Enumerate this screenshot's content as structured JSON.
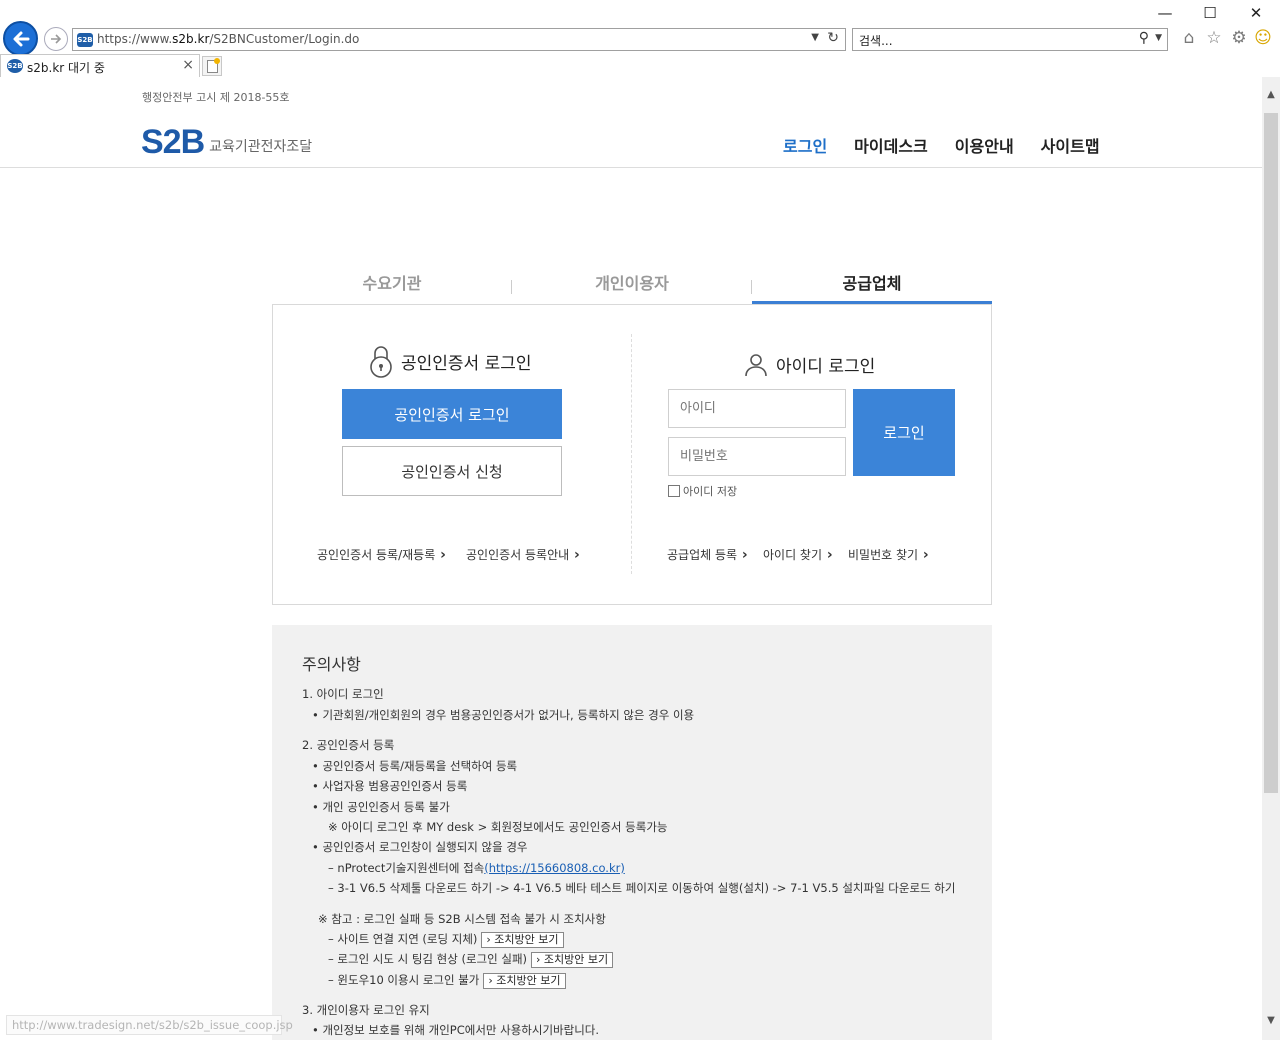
{
  "browser": {
    "url_prefix": "https://www.",
    "url_domain": "s2b.kr",
    "url_path": "/S2BNCustomer/Login.do",
    "search_placeholder": "검색...",
    "tab_title": "s2b.kr 대기 중",
    "favicon_text": "S2B",
    "status_url": "http://www.tradesign.net/s2b/s2b_issue_coop.jsp"
  },
  "header": {
    "notice": "행정안전부 고시 제 2018-55호",
    "logo_mark": "S2B",
    "logo_sub": "교육기관전자조달",
    "nav": [
      "로그인",
      "마이데스크",
      "이용안내",
      "사이트맵"
    ]
  },
  "login_tabs": [
    "수요기관",
    "개인이용자",
    "공급업체"
  ],
  "cert": {
    "title": "공인인증서 로그인",
    "login_button": "공인인증서 로그인",
    "apply_button": "공인인증서 신청",
    "link_register": "공인인증서 등록/재등록",
    "link_guide": "공인인증서 등록안내"
  },
  "id_login": {
    "title": "아이디 로그인",
    "id_placeholder": "아이디",
    "pw_placeholder": "비밀번호",
    "login_button": "로그인",
    "save_id": "아이디 저장",
    "link_supplier": "공급업체 등록",
    "link_find_id": "아이디 찾기",
    "link_find_pw": "비밀번호 찾기"
  },
  "notes": {
    "title": "주의사항",
    "s1": "1. 아이디 로그인",
    "s1_1": "• 기관회원/개인회원의 경우 범용공인인증서가 없거나, 등록하지 않은 경우 이용",
    "s2": "2. 공인인증서 등록",
    "s2_1": "• 공인인증서 등록/재등록을 선택하여 등록",
    "s2_2": "• 사업자용 범용공인인증서 등록",
    "s2_3": "• 개인 공인인증서 등록 불가",
    "s2_3a": "※ 아이디 로그인 후 MY desk > 회원정보에서도 공인인증서 등록가능",
    "s2_4": "• 공인인증서 로그인창이 실행되지 않을 경우",
    "s2_4a": "– nProtect기술지원센터에 접속",
    "s2_4a_link": "(https://15660808.co.kr)",
    "s2_4b": "– 3-1 V6.5 삭제툴 다운로드 하기 -> 4-1 V6.5 베타 테스트 페이지로 이동하여 실행(설치) -> 7-1 V5.5 설치파일 다운로드 하기",
    "ref": "※ 참고 : 로그인 실패 등 S2B 시스템 접속 불가 시 조치사항",
    "ref1": "– 사이트 연결 지연 (로딩 지체)",
    "ref2": "– 로그인 시도 시 팅김 현상 (로그인 실패)",
    "ref3": "– 윈도우10 이용시 로그인 불가",
    "solution": "조치방안 보기",
    "s3": "3. 개인이용자 로그인 유지",
    "s3_1": "• 개인정보 보호를 위해 개인PC에서만 사용하시기바랍니다."
  },
  "colors": {
    "accent": "#3b84d8",
    "logo": "#1e5aa8",
    "nav_active": "#1e6fc8"
  }
}
